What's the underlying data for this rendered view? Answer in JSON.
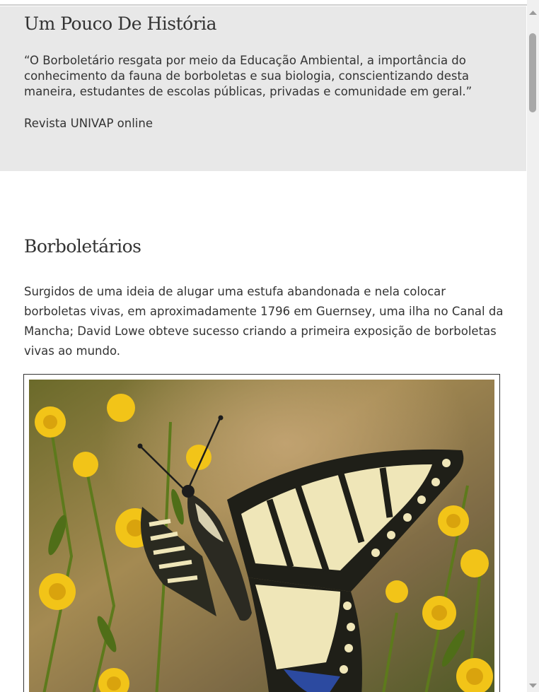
{
  "history": {
    "title": "Um Pouco De História",
    "quote": "“O Borboletário resgata por meio da Educação Ambiental, a importância do conhecimento da fauna de borboletas e sua biologia, conscientizando desta maneira, estudantes de escolas públicas, privadas e comunidade em geral.”",
    "source": "Revista UNIVAP online"
  },
  "borboletarios": {
    "title": "Borboletários",
    "paragraph": "Surgidos de uma ideia de alugar uma estufa abandonada e nela colocar borboletas vivas, em aproximadamente 1796 em Guernsey, uma ilha no Canal da Mancha; David Lowe obteve sucesso criando a primeira exposição de borboletas vivas ao mundo."
  },
  "photo": {
    "subject": "swallowtail-butterfly-on-yellow-flowers"
  },
  "scrollbar": {
    "up_icon": "triangle-up-icon",
    "down_icon": "triangle-down-icon"
  },
  "colors": {
    "section_bg": "#e8e8e8",
    "text": "#333333",
    "flower_yellow": "#f2c418",
    "butterfly_cream": "#efe6b8"
  }
}
